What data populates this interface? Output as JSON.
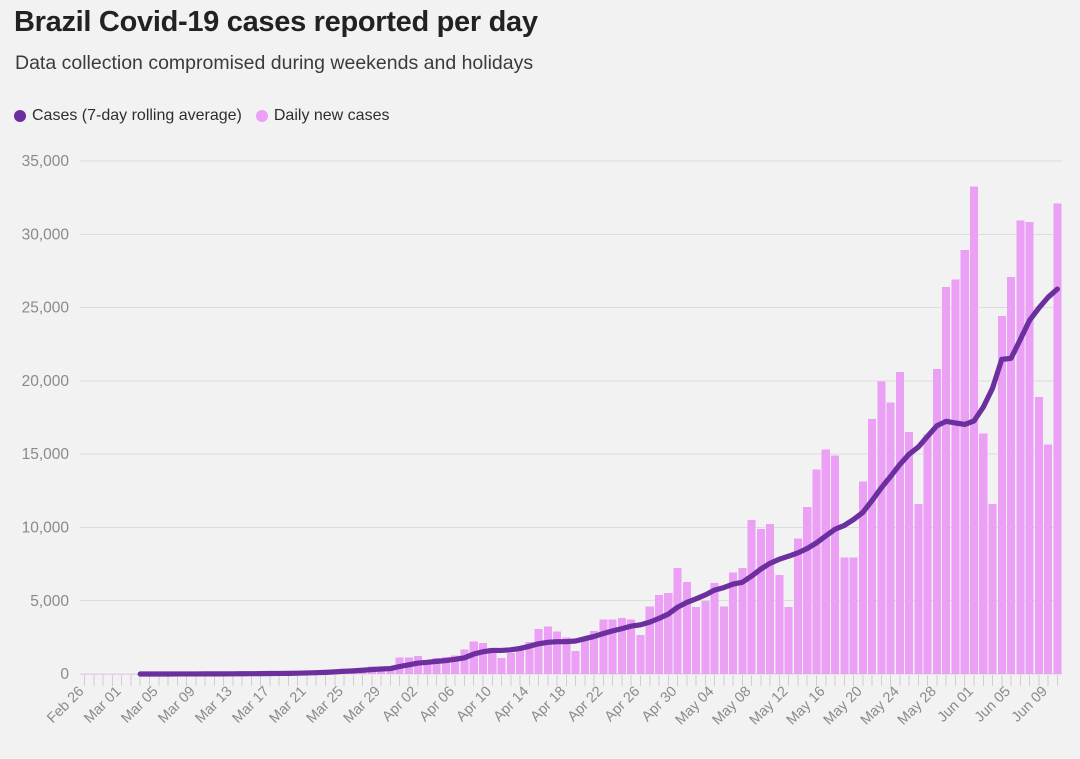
{
  "header": {
    "title": "Brazil Covid-19 cases reported per day",
    "subtitle": "Data collection compromised during weekends and holidays"
  },
  "legend": [
    {
      "label": "Cases (7-day rolling average)",
      "color": "#6b2f9e",
      "marker": "legend-dot-icon"
    },
    {
      "label": "Daily new cases",
      "color": "#eb9ff5",
      "marker": "legend-dot-icon"
    }
  ],
  "colors": {
    "background": "#f2f2f2",
    "bars": "#eb9ff5",
    "line": "#6b2f9e",
    "grid": "#dcdcdc",
    "tick_text": "#8a8a8a",
    "title_text": "#222222"
  },
  "chart_data": {
    "type": "bar",
    "title": "Brazil Covid-19 cases reported per day",
    "subtitle": "Data collection compromised during weekends and holidays",
    "xlabel": "",
    "ylabel": "",
    "ylim": [
      0,
      35000
    ],
    "y_ticks": [
      0,
      5000,
      10000,
      15000,
      20000,
      25000,
      30000,
      35000
    ],
    "y_tick_labels": [
      "0",
      "5,000",
      "10,000",
      "15,000",
      "20,000",
      "25,000",
      "30,000",
      "35,000"
    ],
    "grid": true,
    "legend_position": "top-left",
    "x_tick_labels": [
      "Feb 26",
      "Mar 01",
      "Mar 05",
      "Mar 09",
      "Mar 13",
      "Mar 17",
      "Mar 21",
      "Mar 25",
      "Mar 29",
      "Apr 02",
      "Apr 06",
      "Apr 10",
      "Apr 14",
      "Apr 18",
      "Apr 22",
      "Apr 26",
      "Apr 30",
      "May 04",
      "May 08",
      "May 12",
      "May 16",
      "May 20",
      "May 24",
      "May 28",
      "Jun 01",
      "Jun 05",
      "Jun 09"
    ],
    "x_tick_every": 4,
    "x_start_date": "Feb 26",
    "x_end_date": "Jun 10",
    "dates": [
      "Feb 26",
      "Feb 27",
      "Feb 28",
      "Feb 29",
      "Mar 01",
      "Mar 02",
      "Mar 03",
      "Mar 04",
      "Mar 05",
      "Mar 06",
      "Mar 07",
      "Mar 08",
      "Mar 09",
      "Mar 10",
      "Mar 11",
      "Mar 12",
      "Mar 13",
      "Mar 14",
      "Mar 15",
      "Mar 16",
      "Mar 17",
      "Mar 18",
      "Mar 19",
      "Mar 20",
      "Mar 21",
      "Mar 22",
      "Mar 23",
      "Mar 24",
      "Mar 25",
      "Mar 26",
      "Mar 27",
      "Mar 28",
      "Mar 29",
      "Mar 30",
      "Mar 31",
      "Apr 01",
      "Apr 02",
      "Apr 03",
      "Apr 04",
      "Apr 05",
      "Apr 06",
      "Apr 07",
      "Apr 08",
      "Apr 09",
      "Apr 10",
      "Apr 11",
      "Apr 12",
      "Apr 13",
      "Apr 14",
      "Apr 15",
      "Apr 16",
      "Apr 17",
      "Apr 18",
      "Apr 19",
      "Apr 20",
      "Apr 21",
      "Apr 22",
      "Apr 23",
      "Apr 24",
      "Apr 25",
      "Apr 26",
      "Apr 27",
      "Apr 28",
      "Apr 29",
      "Apr 30",
      "May 01",
      "May 02",
      "May 03",
      "May 04",
      "May 05",
      "May 06",
      "May 07",
      "May 08",
      "May 09",
      "May 10",
      "May 11",
      "May 12",
      "May 13",
      "May 14",
      "May 15",
      "May 16",
      "May 17",
      "May 18",
      "May 19",
      "May 20",
      "May 21",
      "May 22",
      "May 23",
      "May 24",
      "May 25",
      "May 26",
      "May 27",
      "May 28",
      "May 29",
      "May 30",
      "May 31",
      "Jun 01",
      "Jun 02",
      "Jun 03",
      "Jun 04",
      "Jun 05",
      "Jun 06",
      "Jun 07",
      "Jun 08",
      "Jun 09",
      "Jun 10"
    ],
    "series": [
      {
        "name": "Daily new cases",
        "type": "bar",
        "color": "#eb9ff5",
        "values": [
          1,
          0,
          0,
          1,
          0,
          0,
          0,
          1,
          4,
          6,
          6,
          5,
          9,
          9,
          18,
          25,
          29,
          22,
          38,
          39,
          63,
          57,
          70,
          102,
          182,
          176,
          233,
          314,
          362,
          330,
          410,
          502,
          486,
          352,
          1138,
          1119,
          1222,
          852,
          1076,
          1146,
          1269,
          1661,
          2210,
          2105,
          1781,
          1089,
          1442,
          1832,
          2200,
          3058,
          3257,
          2917,
          2498,
          1567,
          2498,
          2923,
          3735,
          3735,
          3808,
          3735,
          2678,
          4613,
          5385,
          5514,
          7218,
          6276,
          4588,
          4970,
          6209,
          4613,
          6935,
          7218,
          10503,
          9888,
          10222,
          6760,
          4588,
          9258,
          11385,
          13944,
          15305,
          14919,
          7938,
          7938,
          13140,
          17408,
          19951,
          18508,
          20599,
          16508,
          11598,
          16324,
          20803,
          26417,
          26928,
          28936,
          33274,
          16409,
          11598,
          24417,
          27075,
          30925,
          30830,
          18912,
          15654,
          32091
        ]
      },
      {
        "name": "Cases (7-day rolling average)",
        "type": "line",
        "color": "#6b2f9e",
        "start_index": 6,
        "values": [
          null,
          null,
          null,
          null,
          null,
          null,
          1,
          1,
          2,
          2,
          3,
          3,
          4,
          6,
          8,
          11,
          14,
          17,
          21,
          24,
          32,
          39,
          45,
          55,
          73,
          88,
          112,
          146,
          182,
          213,
          254,
          301,
          341,
          370,
          512,
          627,
          747,
          796,
          863,
          915,
          1003,
          1106,
          1362,
          1521,
          1607,
          1608,
          1651,
          1746,
          1890,
          2061,
          2160,
          2203,
          2206,
          2253,
          2409,
          2561,
          2764,
          2942,
          3095,
          3268,
          3356,
          3540,
          3796,
          4088,
          4554,
          4880,
          5132,
          5396,
          5723,
          5894,
          6133,
          6258,
          6684,
          7163,
          7559,
          7834,
          8041,
          8267,
          8563,
          8945,
          9420,
          9877,
          10135,
          10541,
          11025,
          11837,
          12703,
          13480,
          14294,
          14998,
          15489,
          16227,
          16940,
          17239,
          17125,
          17027,
          17265,
          18201,
          19500,
          21467,
          21541,
          22823,
          24133,
          24963,
          25704,
          26260
        ]
      }
    ]
  }
}
